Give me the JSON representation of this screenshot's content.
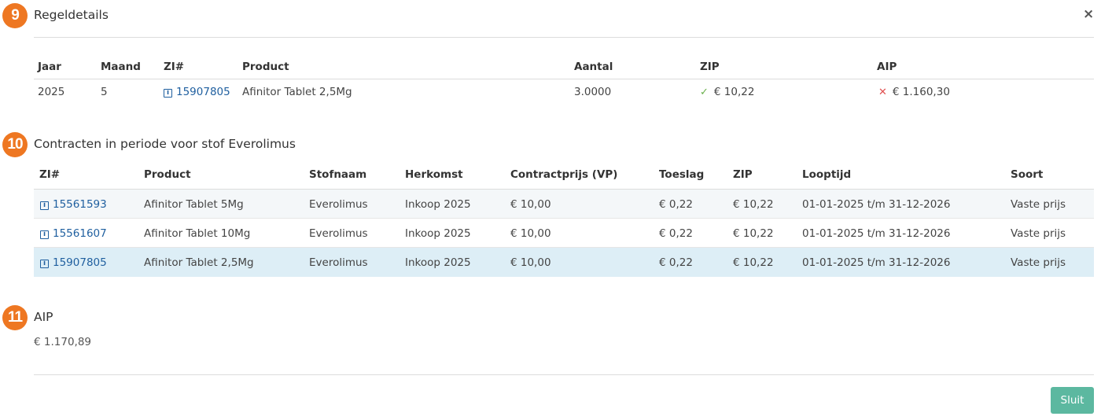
{
  "close_label": "×",
  "sections": {
    "s9": {
      "number": "9",
      "title": "Regeldetails"
    },
    "s10": {
      "number": "10",
      "title": "Contracten in periode voor stof Everolimus"
    },
    "s11": {
      "number": "11",
      "title": "AIP",
      "value": "€ 1.170,89"
    }
  },
  "details": {
    "headers": {
      "jaar": "Jaar",
      "maand": "Maand",
      "zi": "ZI#",
      "product": "Product",
      "aantal": "Aantal",
      "zip": "ZIP",
      "aip": "AIP"
    },
    "row": {
      "jaar": "2025",
      "maand": "5",
      "zi": "15907805",
      "product": "Afinitor Tablet 2,5Mg",
      "aantal": "3.0000",
      "zip": "€ 10,22",
      "aip": "€ 1.160,30"
    },
    "zip_status_icon": "check-icon",
    "aip_status_icon": "cross-icon"
  },
  "contracts": {
    "headers": {
      "zi": "ZI#",
      "product": "Product",
      "stofnaam": "Stofnaam",
      "herkomst": "Herkomst",
      "prijs": "Contractprijs (VP)",
      "toeslag": "Toeslag",
      "zip": "ZIP",
      "looptijd": "Looptijd",
      "soort": "Soort"
    },
    "rows": [
      {
        "zi": "15561593",
        "product": "Afinitor Tablet 5Mg",
        "stofnaam": "Everolimus",
        "herkomst": "Inkoop 2025",
        "prijs": "€ 10,00",
        "toeslag": "€ 0,22",
        "zip": "€ 10,22",
        "looptijd": "01-01-2025 t/m 31-12-2026",
        "soort": "Vaste prijs"
      },
      {
        "zi": "15561607",
        "product": "Afinitor Tablet 10Mg",
        "stofnaam": "Everolimus",
        "herkomst": "Inkoop 2025",
        "prijs": "€ 10,00",
        "toeslag": "€ 0,22",
        "zip": "€ 10,22",
        "looptijd": "01-01-2025 t/m 31-12-2026",
        "soort": "Vaste prijs"
      },
      {
        "zi": "15907805",
        "product": "Afinitor Tablet 2,5Mg",
        "stofnaam": "Everolimus",
        "herkomst": "Inkoop 2025",
        "prijs": "€ 10,00",
        "toeslag": "€ 0,22",
        "zip": "€ 10,22",
        "looptijd": "01-01-2025 t/m 31-12-2026",
        "soort": "Vaste prijs"
      }
    ]
  },
  "footer": {
    "close_button": "Sluit"
  },
  "colors": {
    "badge": "#ee7722",
    "link": "#1f5f9f",
    "button": "#5cb8a0",
    "row_striped": "#f4f7f9",
    "row_highlight": "#ddeef6"
  }
}
